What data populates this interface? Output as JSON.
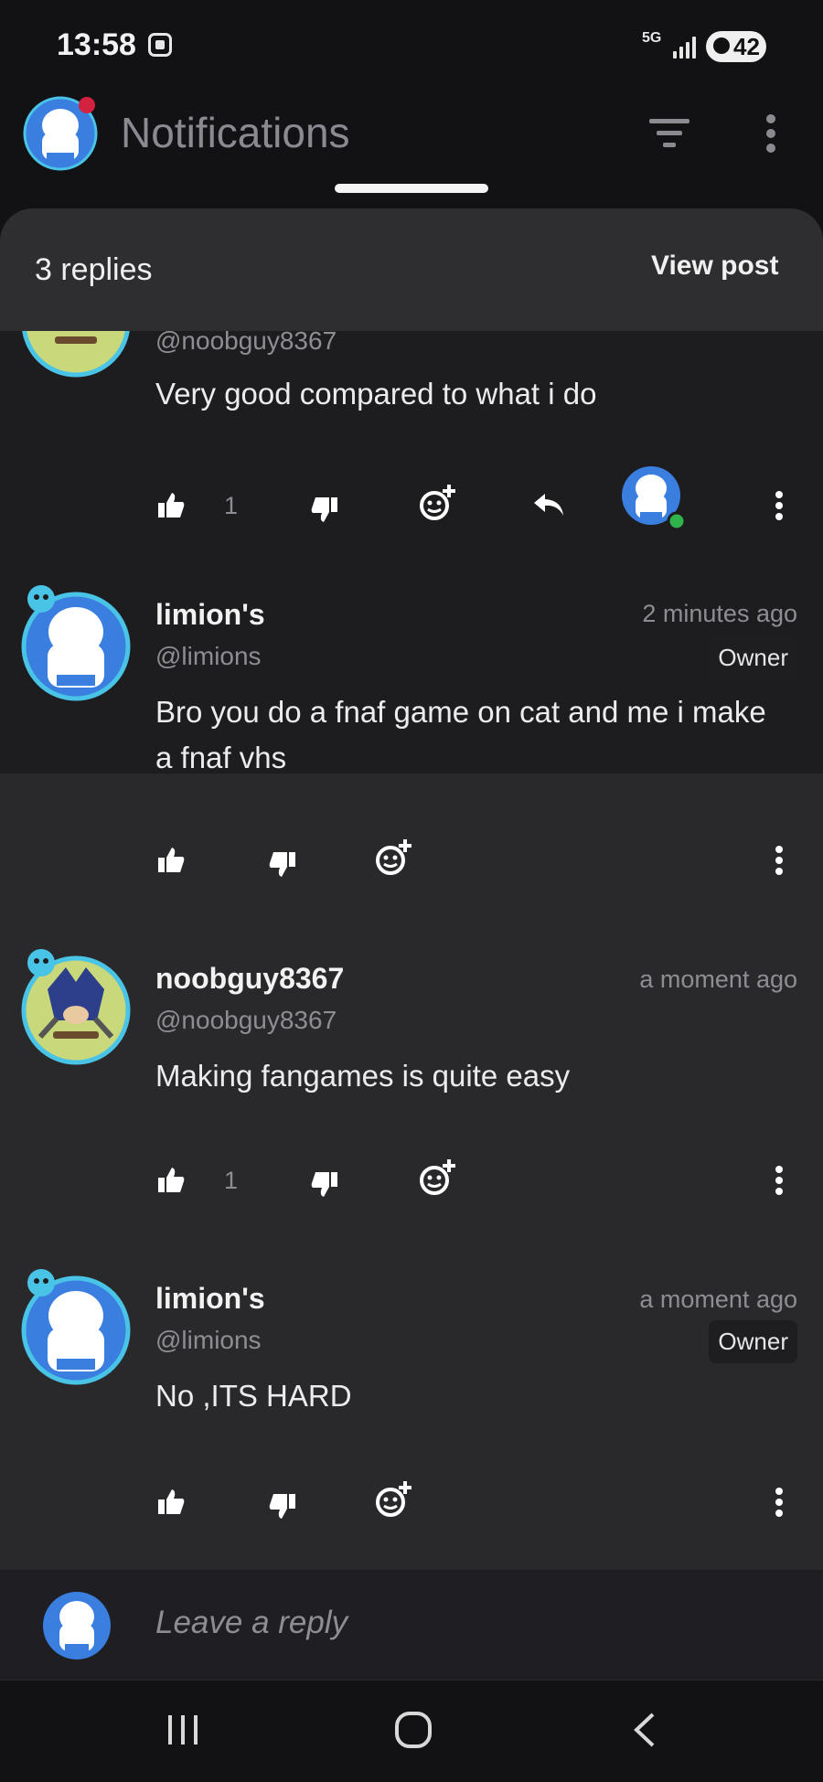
{
  "status_bar": {
    "time": "13:58",
    "network": "5G",
    "battery": "42"
  },
  "header": {
    "title": "Notifications"
  },
  "sheet": {
    "replies_count": "3 replies",
    "view_post": "View post"
  },
  "parent_comment": {
    "handle": "@noobguy8367",
    "text": "Very good compared to what i do",
    "likes": "1"
  },
  "replies": [
    {
      "name": "limion's",
      "handle": "@limions",
      "time": "2 minutes ago",
      "badge": "Owner",
      "text": "Bro you do a fnaf game on cat and me i make a fnaf vhs",
      "likes": ""
    },
    {
      "name": "noobguy8367",
      "handle": "@noobguy8367",
      "time": "a moment ago",
      "badge": "",
      "text": "Making fangames is quite easy",
      "likes": "1"
    },
    {
      "name": "limion's",
      "handle": "@limions",
      "time": "a moment ago",
      "badge": "Owner",
      "text": "No ,ITS HARD",
      "likes": ""
    }
  ],
  "composer": {
    "placeholder": "Leave a reply"
  },
  "icons": {
    "like": "thumbs-up-icon",
    "dislike": "thumbs-down-icon",
    "emoji": "add-emoji-icon",
    "reply": "reply-arrow-icon",
    "more": "more-vertical-icon",
    "filter": "filter-icon",
    "nav_recents": "recents-icon",
    "nav_home": "home-icon",
    "nav_back": "back-icon"
  },
  "colors": {
    "online": "#2fb34a",
    "avatar_blue": "#3a7fe0",
    "avatar_ring": "#49c4e6",
    "notification_dot": "#d3223f"
  }
}
